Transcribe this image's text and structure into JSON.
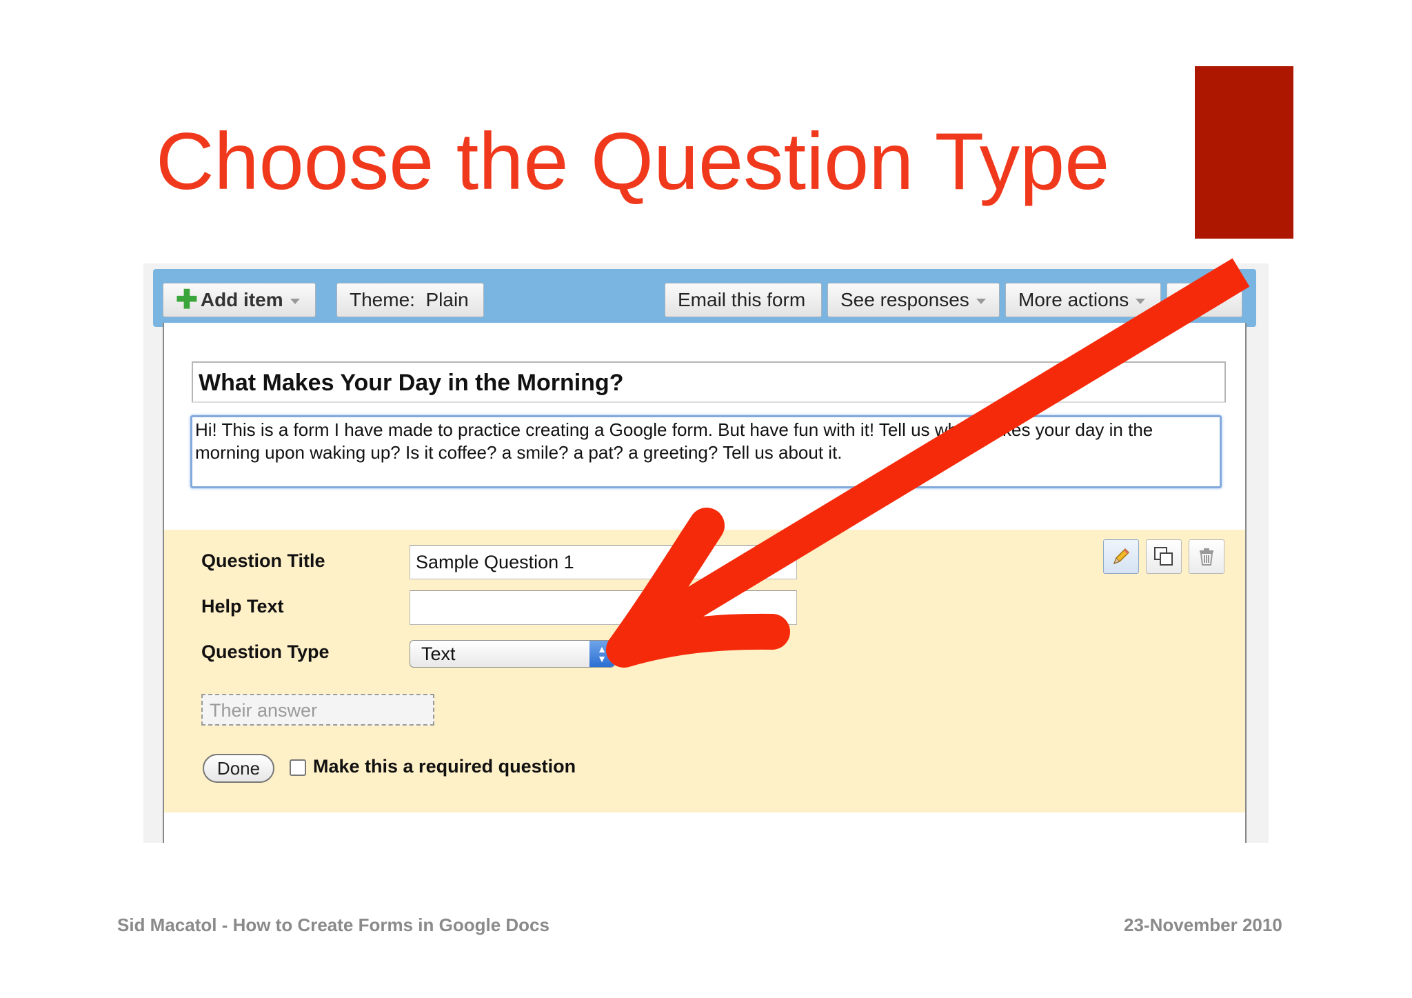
{
  "slide": {
    "title": "Choose the Question Type",
    "footer_left": "Sid Macatol - How to Create Forms in Google Docs",
    "footer_right": "23-November 2010"
  },
  "colors": {
    "title": "#f0391c",
    "accent_block": "#ad1700",
    "arrow": "#f52a0a",
    "toolbar": "#7ab4e0",
    "question_area": "#fef0c7"
  },
  "toolbar": {
    "add_item": "Add item",
    "theme": "Theme:  Plain",
    "email_form": "Email this form",
    "see_responses": "See responses",
    "more_actions": "More actions"
  },
  "form": {
    "title": "What Makes Your Day in the Morning?",
    "description": "Hi! This is a form I have made to practice creating a Google form. But have fun with it! Tell us what makes your day in the morning upon waking up? Is it coffee? a smile? a pat? a greeting? Tell us about it."
  },
  "question": {
    "title_label": "Question Title",
    "title_value": "Sample Question 1",
    "help_label": "Help Text",
    "help_value": "",
    "type_label": "Question Type",
    "type_value": "Text",
    "answer_placeholder": "Their answer",
    "done_label": "Done",
    "required_label": "Make this a required question",
    "required_checked": false
  },
  "icons": [
    "plus-icon",
    "pencil-icon",
    "duplicate-icon",
    "trash-icon",
    "arrow-annotation"
  ]
}
